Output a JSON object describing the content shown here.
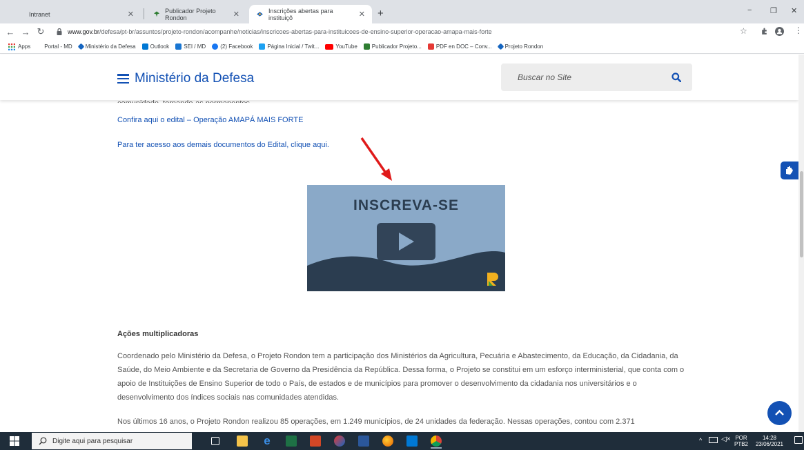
{
  "tabs": [
    {
      "label": "Intranet",
      "favicon_color": "#dee1e6"
    },
    {
      "label": "Publicador Projeto Rondon",
      "favicon_color": "#2e7d32"
    },
    {
      "label": "Inscrições abertas para instituiçõ",
      "favicon_color": "#1565c0"
    }
  ],
  "new_tab_icon": "+",
  "window_controls": {
    "minimize": "−",
    "restore": "❐",
    "close": "✕"
  },
  "address": {
    "domain": "www.gov.br",
    "path": "/defesa/pt-br/assuntos/projeto-rondon/acompanhe/noticias/inscricoes-abertas-para-instituicoes-de-ensino-superior-operacao-amapa-mais-forte"
  },
  "bookmarks": [
    {
      "label": "Apps",
      "color": "#e53935"
    },
    {
      "label": "Portal - MD",
      "color": "#ffffff"
    },
    {
      "label": "Ministério da Defesa",
      "color": "#1565c0"
    },
    {
      "label": "Outlook",
      "color": "#0078d4"
    },
    {
      "label": "SEI / MD",
      "color": "#1976d2"
    },
    {
      "label": "(2) Facebook",
      "color": "#1877f2"
    },
    {
      "label": "Página Inicial / Twit...",
      "color": "#1da1f2"
    },
    {
      "label": "YouTube",
      "color": "#ff0000"
    },
    {
      "label": "Publicador Projeto...",
      "color": "#2e7d32"
    },
    {
      "label": "PDF en DOC – Conv...",
      "color": "#e53935"
    },
    {
      "label": "Projeto Rondon",
      "color": "#1565c0"
    }
  ],
  "site": {
    "title": "Ministério da Defesa",
    "search_placeholder": "Buscar no Site",
    "accent": "#1351b4"
  },
  "content": {
    "cut_text": "comunidade, tornando-as permanentes.",
    "link_edital": "Confira aqui o edital – Operação AMAPÁ MAIS FORTE",
    "link_documentos": "Para ter acesso aos demais documentos do Edital, clique aqui.",
    "video_title": "INSCREVA-SE",
    "heading": "Ações multiplicadoras",
    "paragraph1": "Coordenado pelo Ministério da Defesa, o Projeto Rondon tem a participação dos Ministérios da Agricultura, Pecuária e Abastecimento, da Educação, da Cidadania, da Saúde, do Meio Ambiente e da Secretaria de Governo da Presidência da República. Dessa forma, o Projeto se constitui em um esforço interministerial, que conta com o apoio de Instituições de Ensino Superior de todo o País, de estados e de municípios para promover o desenvolvimento da cidadania nos universitários e o desenvolvimento dos índices sociais nas comunidades atendidas.",
    "paragraph2": "Nos últimos 16 anos, o Projeto Rondon realizou 85 operações, em 1.249 municípios, de 24 unidades da federação. Nessas operações, contou com 2.371"
  },
  "taskbar": {
    "search_placeholder": "Digite aqui para pesquisar",
    "lang_top": "POR",
    "lang_bottom": "PTB2",
    "time": "14:28",
    "date": "23/06/2021"
  }
}
